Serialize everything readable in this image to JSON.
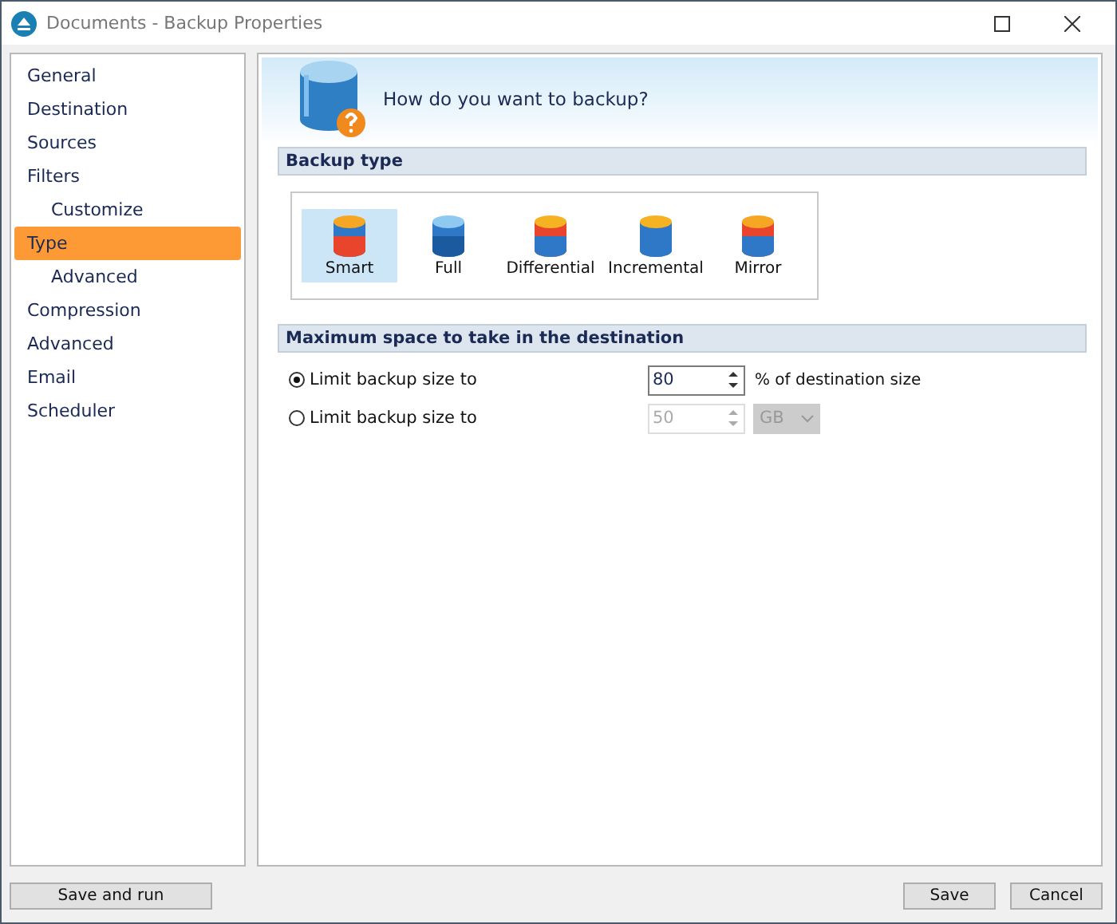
{
  "window": {
    "title": "Documents - Backup Properties"
  },
  "sidebar": {
    "items": [
      {
        "label": "General",
        "selected": false
      },
      {
        "label": "Destination",
        "selected": false
      },
      {
        "label": "Sources",
        "selected": false
      },
      {
        "label": "Filters",
        "selected": false,
        "children": [
          {
            "label": "Customize",
            "selected": false
          }
        ]
      },
      {
        "label": "Type",
        "selected": true,
        "children": [
          {
            "label": "Advanced",
            "selected": false
          }
        ]
      },
      {
        "label": "Compression",
        "selected": false
      },
      {
        "label": "Advanced",
        "selected": false
      },
      {
        "label": "Email",
        "selected": false
      },
      {
        "label": "Scheduler",
        "selected": false
      }
    ]
  },
  "header": {
    "title": "How do you want to backup?"
  },
  "backup_type": {
    "heading": "Backup type",
    "options": [
      {
        "label": "Smart",
        "kind": "smart",
        "selected": true
      },
      {
        "label": "Full",
        "kind": "full",
        "selected": false
      },
      {
        "label": "Differential",
        "kind": "differential",
        "selected": false
      },
      {
        "label": "Incremental",
        "kind": "incremental",
        "selected": false
      },
      {
        "label": "Mirror",
        "kind": "mirror",
        "selected": false
      }
    ]
  },
  "max_space": {
    "heading": "Maximum space to take in the destination",
    "options": [
      {
        "label": "Limit backup size to",
        "selected": true,
        "value": "80",
        "disabled": false,
        "unit_text": "% of destination size"
      },
      {
        "label": "Limit backup size to",
        "selected": false,
        "value": "50",
        "disabled": true,
        "unit_dropdown": "GB"
      }
    ]
  },
  "buttons": {
    "left": [
      "Save and run"
    ],
    "right": [
      "Save",
      "Cancel"
    ]
  }
}
